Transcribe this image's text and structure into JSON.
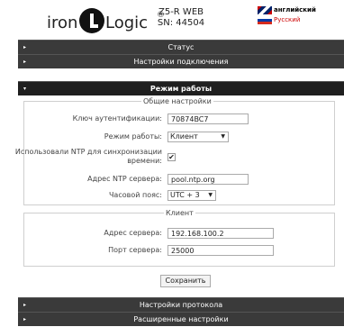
{
  "brand": {
    "part1": "iron",
    "part2": "Logic",
    "reg": "®"
  },
  "device": {
    "line1": "Z5-R WEB",
    "line2": "SN: 44504"
  },
  "lang": {
    "english": "английский",
    "russian": "Русский"
  },
  "menu": {
    "status": "Статус",
    "connection": "Настройки подключения",
    "mode": "Режим работы",
    "protocol": "Настройки протокола",
    "advanced": "Расширенные настройки"
  },
  "general": {
    "legend": "Общие настройки",
    "auth_key_label": "Ключ аутентификации:",
    "auth_key_value": "70874BC7",
    "mode_label": "Режим работы:",
    "mode_value": "Клиент",
    "ntp_label_1": "Использовали NTP для синхронизации",
    "ntp_label_2": "времени:",
    "ntp_checked": "✔",
    "ntp_server_label": "Адрес NTP сервера:",
    "ntp_server_value": "pool.ntp.org",
    "tz_label": "Часовой пояс:",
    "tz_value": "UTC + 3"
  },
  "client": {
    "legend": "Клиент",
    "server_addr_label": "Адрес сервера:",
    "server_addr_value": "192.168.100.2",
    "server_port_label": "Порт сервера:",
    "server_port_value": "25000"
  },
  "actions": {
    "save": "Сохранить"
  }
}
